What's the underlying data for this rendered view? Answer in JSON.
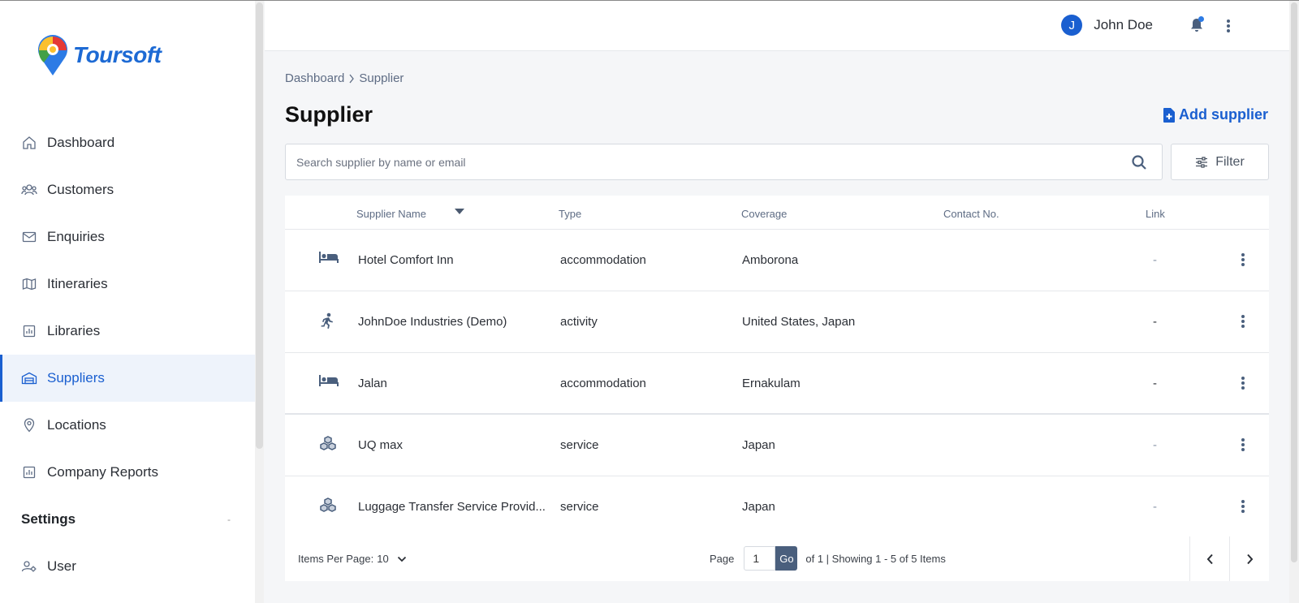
{
  "brand": {
    "name": "Toursoft"
  },
  "sidebar": {
    "items": [
      {
        "label": "Dashboard",
        "icon": "home-icon"
      },
      {
        "label": "Customers",
        "icon": "users-icon"
      },
      {
        "label": "Enquiries",
        "icon": "mail-icon"
      },
      {
        "label": "Itineraries",
        "icon": "map-icon"
      },
      {
        "label": "Libraries",
        "icon": "chart-icon"
      },
      {
        "label": "Suppliers",
        "icon": "building-icon",
        "active": true
      },
      {
        "label": "Locations",
        "icon": "pin-icon"
      },
      {
        "label": "Company Reports",
        "icon": "report-icon"
      }
    ],
    "settings_section": {
      "label": "Settings",
      "collapse_glyph": "-"
    },
    "settings_items": [
      {
        "label": "User",
        "icon": "user-gear-icon"
      }
    ]
  },
  "header": {
    "user_initial": "J",
    "user_name": "John Doe"
  },
  "breadcrumb": {
    "root": "Dashboard",
    "current": "Supplier"
  },
  "page": {
    "title": "Supplier",
    "add_label": "Add supplier"
  },
  "search": {
    "placeholder": "Search supplier by name or email",
    "value": ""
  },
  "filter": {
    "label": "Filter"
  },
  "table": {
    "columns": [
      "Supplier Name",
      "Type",
      "Coverage",
      "Contact No.",
      "Link"
    ],
    "rows": [
      {
        "icon": "bed-icon",
        "name": "Hotel Comfort Inn",
        "type": "accommodation",
        "coverage": "Amborona",
        "contact": "",
        "link": "-"
      },
      {
        "icon": "running-icon",
        "name": "JohnDoe Industries (Demo)",
        "type": "activity",
        "coverage": "United States, Japan",
        "contact": "",
        "link": "-"
      },
      {
        "icon": "bed-icon",
        "name": "Jalan",
        "type": "accommodation",
        "coverage": "Ernakulam",
        "contact": "",
        "link": "-"
      },
      {
        "icon": "boxes-icon",
        "name": "UQ max",
        "type": "service",
        "coverage": "Japan",
        "contact": "",
        "link": "-"
      },
      {
        "icon": "boxes-icon",
        "name": "Luggage Transfer Service Provid...",
        "type": "service",
        "coverage": "Japan",
        "contact": "",
        "link": "-"
      }
    ]
  },
  "pagination": {
    "items_per_page_label": "Items Per Page:",
    "items_per_page": "10",
    "page_label": "Page",
    "page_value": "1",
    "go_label": "Go",
    "summary": "of 1 | Showing 1 - 5 of 5 Items"
  },
  "colors": {
    "accent": "#1a5fd0",
    "go_button": "#4a5f7d",
    "active_bg": "#eef3fb"
  }
}
